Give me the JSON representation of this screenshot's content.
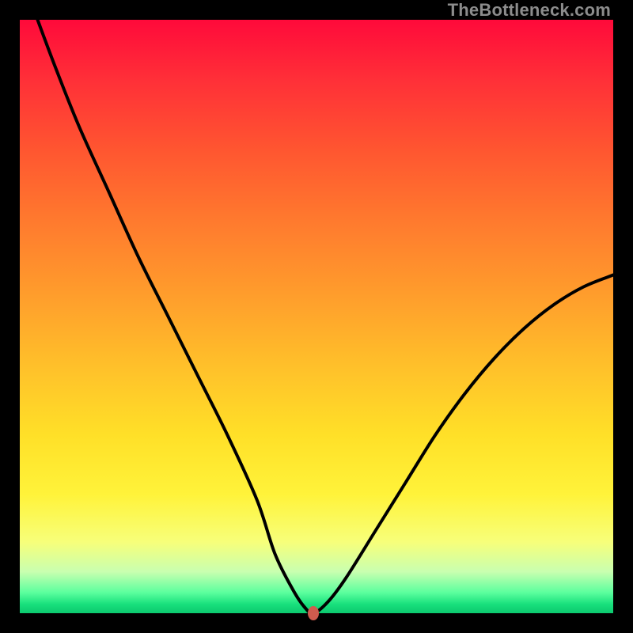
{
  "watermark": "TheBottleneck.com",
  "chart_data": {
    "type": "line",
    "title": "",
    "xlabel": "",
    "ylabel": "",
    "xlim": [
      0,
      100
    ],
    "ylim": [
      0,
      100
    ],
    "grid": false,
    "legend": false,
    "background_gradient": {
      "orientation": "vertical",
      "stops": [
        {
          "pos": 0,
          "color": "#ff0a3a"
        },
        {
          "pos": 0.22,
          "color": "#ff5630"
        },
        {
          "pos": 0.46,
          "color": "#ff9c2c"
        },
        {
          "pos": 0.7,
          "color": "#ffe028"
        },
        {
          "pos": 0.88,
          "color": "#f7ff7a"
        },
        {
          "pos": 0.965,
          "color": "#5cff9e"
        },
        {
          "pos": 1.0,
          "color": "#0dc96f"
        }
      ]
    },
    "series": [
      {
        "name": "bottleneck-curve",
        "x": [
          3,
          6,
          10,
          15,
          20,
          25,
          30,
          35,
          40,
          43,
          46,
          48,
          49.5,
          52,
          55,
          60,
          65,
          70,
          75,
          80,
          85,
          90,
          95,
          100
        ],
        "y": [
          100,
          92,
          82,
          71,
          60,
          50,
          40,
          30,
          19,
          10,
          4,
          1,
          0,
          2,
          6,
          14,
          22,
          30,
          37,
          43,
          48,
          52,
          55,
          57
        ],
        "color": "#000000"
      }
    ],
    "marker": {
      "x": 49.5,
      "y": 0,
      "color": "#cf5b4e"
    }
  }
}
